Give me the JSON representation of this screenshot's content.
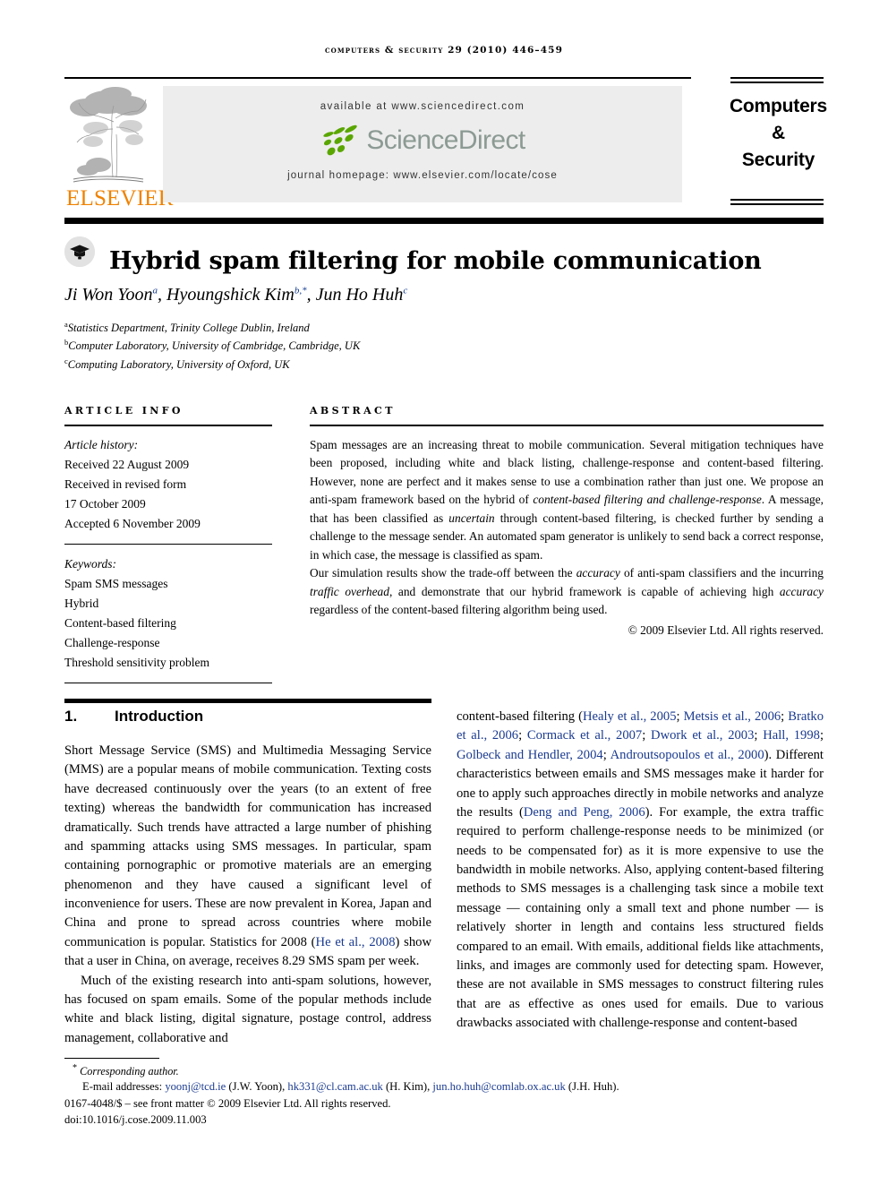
{
  "running_head": "COMPUTERS & SECURITY 29 (2010) 446–459",
  "masthead": {
    "publisher_logo_alt": "elsevier-tree-logo",
    "publisher_name": "ELSEVIER",
    "available_at": "available at www.sciencedirect.com",
    "sciencedirect_brand": "ScienceDirect",
    "journal_homepage": "journal homepage: www.elsevier.com/locate/cose",
    "journal_title_lines": [
      "Computers",
      "&",
      "Security"
    ],
    "colors": {
      "elsevier_orange": "#EF8200",
      "sciencedirect_gray": "#8c9a94",
      "sciencedirect_green": "#5aa600",
      "panel_gray": "#ededed"
    }
  },
  "article": {
    "title": "Hybrid spam filtering for mobile communication",
    "title_icon": "graduation-cap-icon",
    "authors_html": "Ji Won Yoon<sup>a</sup>, Hyoungshick Kim<sup>b,*</sup>, Jun Ho Huh<sup>c</sup>",
    "affiliations": [
      {
        "marker": "a",
        "text": "Statistics Department, Trinity College Dublin, Ireland"
      },
      {
        "marker": "b",
        "text": "Computer Laboratory, University of Cambridge, Cambridge, UK"
      },
      {
        "marker": "c",
        "text": "Computing Laboratory, University of Oxford, UK"
      }
    ]
  },
  "article_info": {
    "label": "ARTICLE INFO",
    "history_label": "Article history:",
    "history": [
      "Received 22 August 2009",
      "Received in revised form",
      "17 October 2009",
      "Accepted 6 November 2009"
    ],
    "keywords_label": "Keywords:",
    "keywords": [
      "Spam SMS messages",
      "Hybrid",
      "Content-based filtering",
      "Challenge-response",
      "Threshold sensitivity problem"
    ]
  },
  "abstract": {
    "label": "ABSTRACT",
    "paragraph_1": "Spam messages are an increasing threat to mobile communication. Several mitigation techniques have been proposed, including white and black listing, challenge-response and content-based filtering. However, none are perfect and it makes sense to use a combination rather than just one. We propose an anti-spam framework based on the hybrid of content-based filtering and challenge-response. A message, that has been classified as uncertain through content-based filtering, is checked further by sending a challenge to the message sender. An automated spam generator is unlikely to send back a correct response, in which case, the message is classified as spam.",
    "paragraph_2": "Our simulation results show the trade-off between the accuracy of anti-spam classifiers and the incurring traffic overhead, and demonstrate that our hybrid framework is capable of achieving high accuracy regardless of the content-based filtering algorithm being used.",
    "copyright": "© 2009 Elsevier Ltd. All rights reserved."
  },
  "introduction": {
    "number": "1.",
    "heading": "Introduction",
    "left_paragraph_1": "Short Message Service (SMS) and Multimedia Messaging Service (MMS) are a popular means of mobile communication. Texting costs have decreased continuously over the years (to an extent of free texting) whereas the bandwidth for communication has increased dramatically. Such trends have attracted a large number of phishing and spamming attacks using SMS messages. In particular, spam containing pornographic or promotive materials are an emerging phenomenon and they have caused a significant level of inconvenience for users. These are now prevalent in Korea, Japan and China and prone to spread across countries where mobile communication is popular. Statistics for 2008 (He et al., 2008) show that a user in China, on average, receives 8.29 SMS spam per week.",
    "left_paragraph_2": "Much of the existing research into anti-spam solutions, however, has focused on spam emails. Some of the popular methods include white and black listing, digital signature, postage control, address management, collaborative and",
    "right_paragraph_1": "content-based filtering (Healy et al., 2005; Metsis et al., 2006; Bratko et al., 2006; Cormack et al., 2007; Dwork et al., 2003; Hall, 1998; Golbeck and Hendler, 2004; Androutsopoulos et al., 2000). Different characteristics between emails and SMS messages make it harder for one to apply such approaches directly in mobile networks and analyze the results (Deng and Peng, 2006). For example, the extra traffic required to perform challenge-response needs to be minimized (or needs to be compensated for) as it is more expensive to use the bandwidth in mobile networks. Also, applying content-based filtering methods to SMS messages is a challenging task since a mobile text message — containing only a small text and phone number — is relatively shorter in length and contains less structured fields compared to an email. With emails, additional fields like attachments, links, and images are commonly used for detecting spam. However, these are not available in SMS messages to construct filtering rules that are as effective as ones used for emails. Due to various drawbacks associated with challenge-response and content-based",
    "citations_left": [
      "He et al., 2008"
    ],
    "citations_right": [
      "Healy et al., 2005",
      "Metsis et al., 2006",
      "Bratko et al., 2006",
      "Cormack et al., 2007",
      "Dwork et al., 2003",
      "Hall, 1998",
      "Golbeck and Hendler, 2004",
      "Androutsopoulos et al., 2000",
      "Deng and Peng, 2006"
    ]
  },
  "footnote": {
    "corresponding": "Corresponding author.",
    "email_label": "E-mail addresses:",
    "emails": [
      {
        "address": "yoonj@tcd.ie",
        "person": "(J.W. Yoon)"
      },
      {
        "address": "hk331@cl.cam.ac.uk",
        "person": "(H. Kim)"
      },
      {
        "address": "jun.ho.huh@comlab.ox.ac.uk",
        "person": "(J.H. Huh)"
      }
    ],
    "front_matter": "0167-4048/$ – see front matter © 2009 Elsevier Ltd. All rights reserved.",
    "doi": "doi:10.1016/j.cose.2009.11.003"
  }
}
